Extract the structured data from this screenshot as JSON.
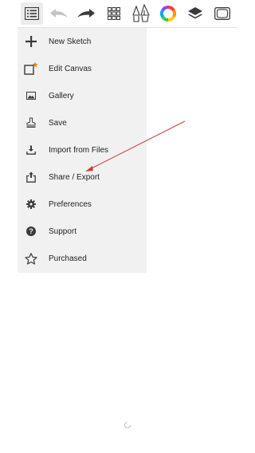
{
  "toolbar": {
    "buttons": [
      {
        "name": "menu-list",
        "icon": "list-icon",
        "active": true
      },
      {
        "name": "undo",
        "icon": "undo-arrow-icon",
        "disabled": true
      },
      {
        "name": "redo",
        "icon": "redo-arrow-icon",
        "disabled": false
      },
      {
        "name": "grid",
        "icon": "grid-icon"
      },
      {
        "name": "brushes",
        "icon": "pen-nib-icon"
      },
      {
        "name": "color",
        "icon": "color-wheel-icon"
      },
      {
        "name": "layers",
        "icon": "layers-icon"
      },
      {
        "name": "canvas-view",
        "icon": "screen-frame-icon"
      }
    ]
  },
  "menu": {
    "items": [
      {
        "label": "New Sketch",
        "icon": "plus-icon"
      },
      {
        "label": "Edit Canvas",
        "icon": "canvas-edit-icon"
      },
      {
        "label": "Gallery",
        "icon": "gallery-icon"
      },
      {
        "label": "Save",
        "icon": "save-stamp-icon"
      },
      {
        "label": "Import from Files",
        "icon": "import-icon"
      },
      {
        "label": "Share / Export",
        "icon": "share-icon"
      },
      {
        "label": "Preferences",
        "icon": "gear-icon"
      },
      {
        "label": "Support",
        "icon": "help-icon"
      },
      {
        "label": "Purchased",
        "icon": "star-icon"
      }
    ]
  },
  "colors": {
    "annotation": "#d23b3b",
    "accent_orange": "#f07c1e",
    "menu_bg": "#f1f1f1",
    "icon": "#3a3a3a",
    "disabled_icon": "#c4c4c4"
  }
}
